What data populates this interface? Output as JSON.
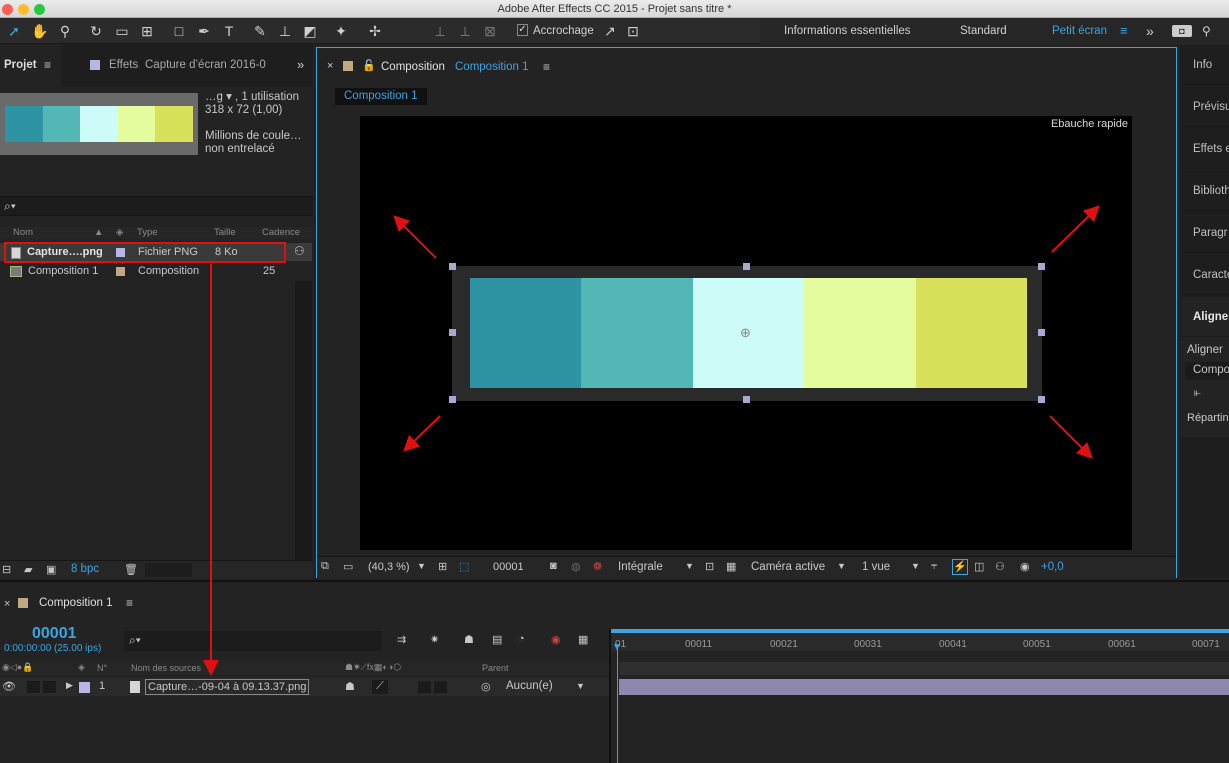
{
  "window": {
    "title": "Adobe After Effects CC 2015 - Projet sans titre *"
  },
  "toolbar": {
    "snapping_label": "Accrochage",
    "workspaces": [
      "Informations essentielles",
      "Standard",
      "Petit écran"
    ],
    "active_workspace": "Petit écran",
    "more": "»"
  },
  "project": {
    "tab_label": "Projet",
    "effects_tab_label": "Effets",
    "effects_tab_target": "Capture d’écran 2016-0",
    "preview_info": [
      "…g ▾ , 1 utilisation",
      "318 x 72 (1,00)",
      "Millions de coule…",
      "non entrelacé"
    ],
    "search_placeholder": "⌕▾",
    "columns": [
      "Nom",
      "Type",
      "Taille",
      "Cadence"
    ],
    "items": [
      {
        "name": "Capture….png",
        "type": "Fichier PNG",
        "size": "8 Ko",
        "rate": ""
      },
      {
        "name": "Composition 1",
        "type": "Composition",
        "size": "",
        "rate": "25"
      }
    ],
    "bpc_label": "8 bpc"
  },
  "composition": {
    "panel_label": "Composition",
    "comp_name": "Composition 1",
    "tab_chip": "Composition 1",
    "draft_label": "Ebauche rapide",
    "zoom": "(40,3 %)",
    "frame": "00001",
    "resolution": "Intégrale",
    "camera": "Caméra active",
    "views": "1 vue",
    "exposure": "+0,0",
    "palette": [
      "#2e93a2",
      "#53b8b5",
      "#ccfbf8",
      "#e4fc9e",
      "#d8e15a"
    ]
  },
  "right_panel": {
    "tabs": [
      "Info",
      "Prévisu",
      "Effets e",
      "Biblioth",
      "Paragr",
      "Caracte",
      "Aligner"
    ],
    "align_label": "Aligner",
    "align_target": "Compo",
    "distribute_label": "Répartin"
  },
  "timeline": {
    "tab_label": "Composition 1",
    "timecode": "00001",
    "timecode_detail": "0:00:00:00 (25.00 ips)",
    "search_placeholder": "⌕▾",
    "header_no": "N°",
    "header_source": "Nom des sources",
    "header_parent": "Parent",
    "ruler": [
      "01",
      "00011",
      "00021",
      "00031",
      "00041",
      "00051",
      "00061",
      "00071"
    ],
    "layer": {
      "index": "1",
      "name": "Capture…-09-04 à 09.13.37.png",
      "parent": "Aucun(e)"
    }
  },
  "colors": {
    "accent": "#3fa3e0",
    "annotation": "#e01010"
  }
}
